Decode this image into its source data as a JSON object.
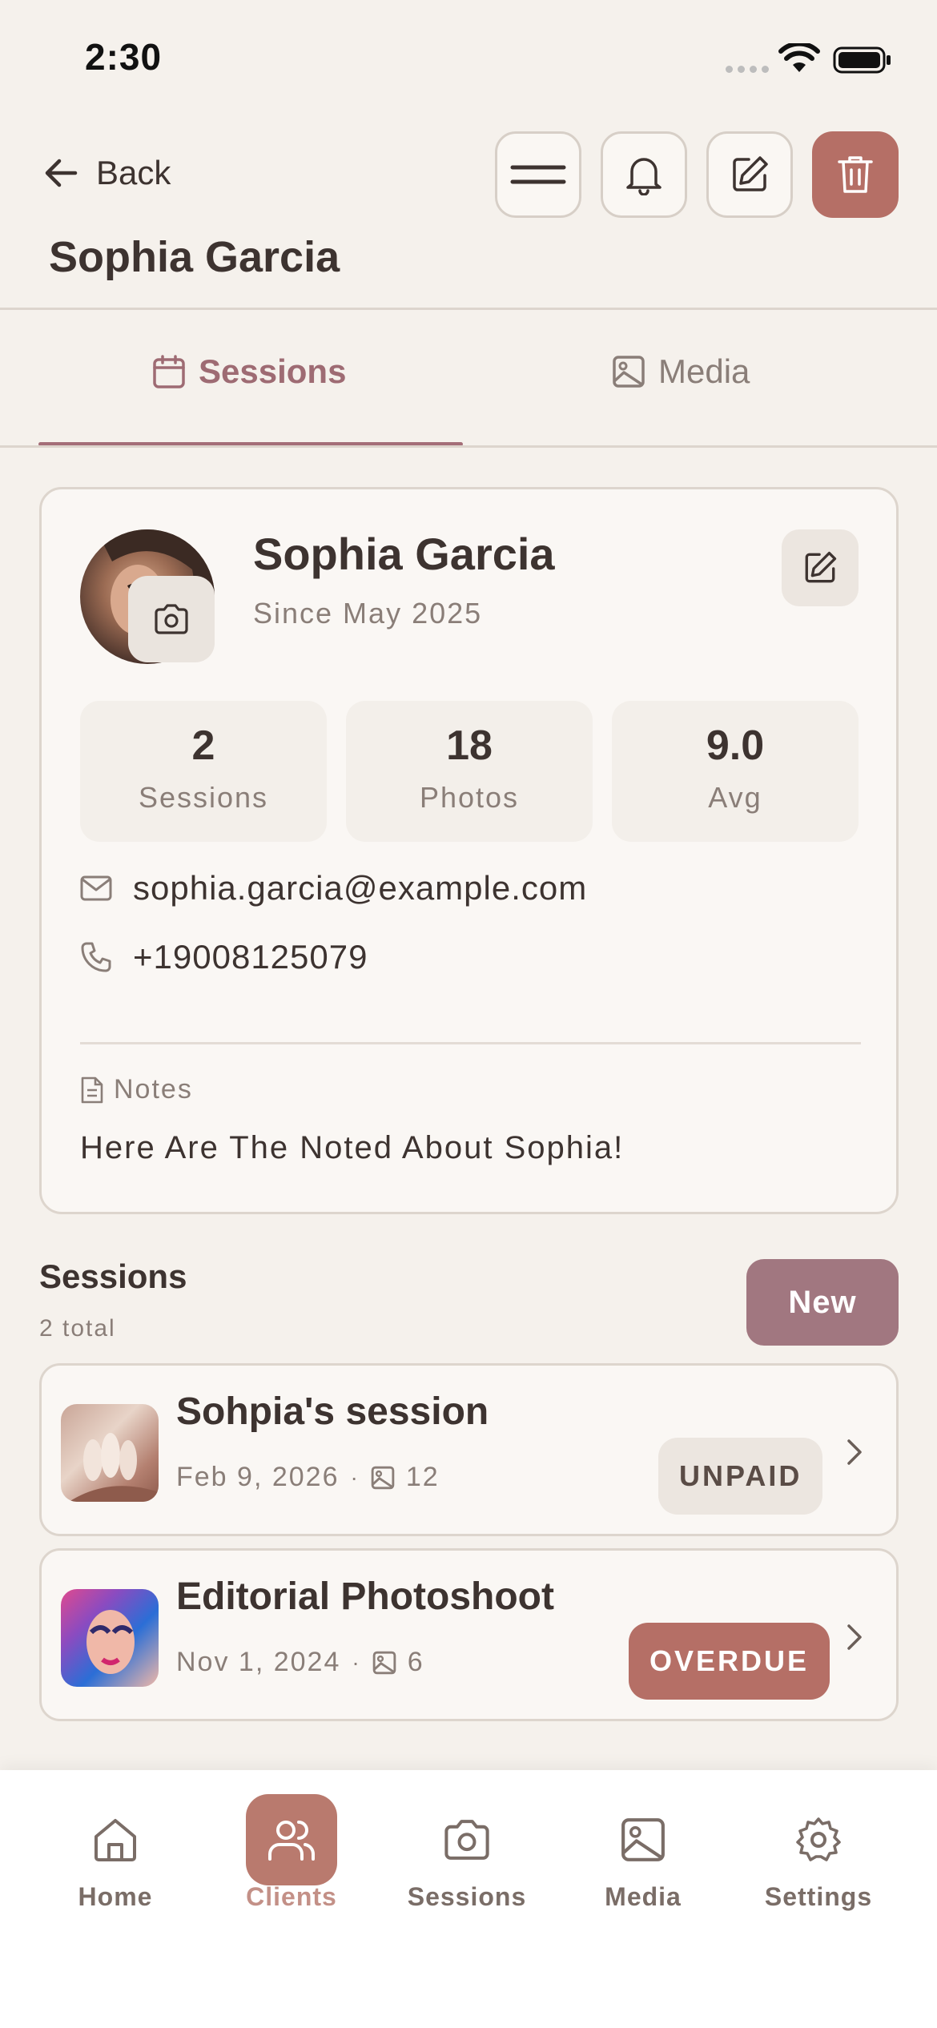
{
  "status_bar": {
    "time": "2:30"
  },
  "header": {
    "back_label": "Back",
    "title": "Sophia Garcia",
    "buttons": [
      "menu-icon",
      "bell-icon",
      "edit-icon",
      "trash-icon"
    ]
  },
  "tabs": [
    {
      "label": "Sessions",
      "icon": "calendar-icon",
      "active": true
    },
    {
      "label": "Media",
      "icon": "image-icon",
      "active": false
    }
  ],
  "profile": {
    "name": "Sophia Garcia",
    "since": "Since May 2025",
    "stats": [
      {
        "value": "2",
        "label": "Sessions"
      },
      {
        "value": "18",
        "label": "Photos"
      },
      {
        "value": "9.0",
        "label": "Avg"
      }
    ],
    "email": "sophia.garcia@example.com",
    "phone": "+19008125079",
    "notes_label": "Notes",
    "notes": "Here Are The Noted About Sophia!"
  },
  "sessions": {
    "title": "Sessions",
    "count": "2 total",
    "new_label": "New",
    "items": [
      {
        "name": "Sohpia's session",
        "date": "Feb 9, 2026",
        "photos": "12",
        "status": "UNPAID"
      },
      {
        "name": "Editorial Photoshoot",
        "date": "Nov 1, 2024",
        "photos": "6",
        "status": "OVERDUE"
      }
    ]
  },
  "bottom_nav": [
    {
      "label": "Home",
      "icon": "home-icon",
      "active": false
    },
    {
      "label": "Clients",
      "icon": "users-icon",
      "active": true
    },
    {
      "label": "Sessions",
      "icon": "camera-icon",
      "active": false
    },
    {
      "label": "Media",
      "icon": "image-icon",
      "active": false
    },
    {
      "label": "Settings",
      "icon": "gear-icon",
      "active": false
    }
  ],
  "colors": {
    "accent": "#a17780",
    "danger": "#b56f66",
    "background": "#f5f1ec",
    "card": "#faf7f4"
  }
}
